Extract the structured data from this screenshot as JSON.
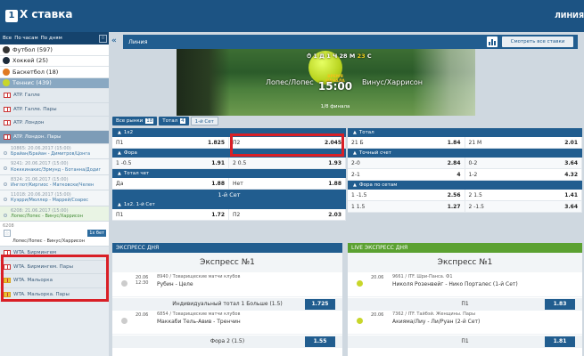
{
  "header": {
    "logo_num": "1",
    "logo_text": "X ставка",
    "nav_right": "ЛИНИЯ"
  },
  "sidebar": {
    "filters": [
      "Все",
      "По часам",
      "По дням"
    ],
    "pin": "☆",
    "collapse": "«",
    "sports": [
      {
        "label": "Футбол (597)",
        "color": "#333"
      },
      {
        "label": "Хоккей (25)",
        "color": "#1b2a3a"
      },
      {
        "label": "Баскетбол (18)",
        "color": "#e07a22"
      },
      {
        "label": "Теннис (439)",
        "color": "#c8d62a"
      }
    ],
    "leagues": [
      {
        "label": "ATP. Галле",
        "en": ""
      },
      {
        "label": "ATP. Галле. Пары",
        "en": ""
      },
      {
        "label": "ATP. Лондон",
        "en": ""
      },
      {
        "label": "ATP. Лондон. Пары",
        "en": ""
      }
    ],
    "games": [
      {
        "meta": "10865: 20.06.2017 (15:00)",
        "title": "Брайан/Брайан - Димитров/Цонга"
      },
      {
        "meta": "9241: 20.06.2017 (15:00)",
        "title": "Кокккинакис/Эрмунд - Ботанна/Додиг"
      },
      {
        "meta": "8324: 21.06.2017 (15:00)",
        "title": "Инглот/Киргиос - Матковски/Челен"
      },
      {
        "meta": "11018: 20.06.2017 (15:00)",
        "title": "Куэрри/Мюллер - Маррей/Соарес"
      },
      {
        "meta": "6208: 21.06.2017 (15:00)",
        "title": "Лопес/Лопес - Винус/Харрисон"
      }
    ],
    "slip": {
      "code": "6208",
      "label": "П2",
      "odd": "1х бет",
      "text": "Лопес/Лопес - Винус/Харрисон"
    },
    "leagues2": [
      {
        "label": "WTA. Бирмингем"
      },
      {
        "label": "WTA. Бирмингем. Пары"
      },
      {
        "label": "WTA. Мальорка"
      },
      {
        "label": "WTA. Мальорка. Пары"
      }
    ]
  },
  "main": {
    "collapse": "«",
    "line_title": "Линия",
    "all_bets": "Смотреть все ставки",
    "timer": {
      "a": "1",
      "d": "Д",
      "b": "1",
      "h": "Ч",
      "c": "28",
      "m": "М",
      "s": "23",
      "sl": "С"
    },
    "team_left": "Лопес/Лопес",
    "team_right": "Винус/Харрисон",
    "starts_label": "ВРЕМЯ НАЧАЛА",
    "start_time": "15:00",
    "round": "1/8 финала",
    "tabs": [
      {
        "label": "Все рынки",
        "n": "18"
      },
      {
        "label": "Тотал",
        "n": "4"
      },
      {
        "label": "1-й Сет",
        "n": ""
      }
    ],
    "m1x2": {
      "title": "1х2",
      "rows": [
        [
          {
            "l": "П1",
            "o": "1.825"
          },
          {
            "l": "П2",
            "o": "2.045"
          }
        ]
      ]
    },
    "fora": {
      "title": "Фора",
      "rows": [
        [
          {
            "l": "1 -0.5",
            "o": "1.91"
          },
          {
            "l": "2 0.5",
            "o": "1.93"
          }
        ]
      ]
    },
    "totalchet": {
      "title": "Тотал чет",
      "rows": [
        [
          {
            "l": "Да",
            "o": "1.88"
          },
          {
            "l": "Нет",
            "o": "1.88"
          }
        ]
      ]
    },
    "set1": "1-й Сет",
    "set1x2": {
      "title": "1х2. 1-й Сет",
      "rows": [
        [
          {
            "l": "П1",
            "o": "1.72"
          },
          {
            "l": "П2",
            "o": "2.03"
          }
        ]
      ]
    },
    "total": {
      "title": "Тотал",
      "rows": [
        [
          {
            "l": "21 Б",
            "o": "1.84"
          },
          {
            "l": "21 М",
            "o": "2.01"
          }
        ]
      ]
    },
    "exact": {
      "title": "Точный счет",
      "rows": [
        [
          {
            "l": "2-0",
            "o": "2.84"
          },
          {
            "l": "0-2",
            "o": "3.64"
          }
        ],
        [
          {
            "l": "2-1",
            "o": "4"
          },
          {
            "l": "1-2",
            "o": "4.32"
          }
        ]
      ]
    },
    "forasets": {
      "title": "Фора по сетам",
      "rows": [
        [
          {
            "l": "1 -1.5",
            "o": "2.56"
          },
          {
            "l": "2 1.5",
            "o": "1.41"
          }
        ],
        [
          {
            "l": "1 1.5",
            "o": "1.27"
          },
          {
            "l": "2 -1.5",
            "o": "3.64"
          }
        ]
      ]
    }
  },
  "express": {
    "day": {
      "header": "ЭКСПРЕСС ДНЯ",
      "title": "Экспресс №1",
      "items": [
        {
          "date": "20.06",
          "time": "12:30",
          "league": "8940 / Товарищеские матчи клубов",
          "match": "Рубин - Целе",
          "bet": "Индивидуальный тотал 1 Больше (1.5)",
          "odd": "1.725"
        },
        {
          "date": "20.06",
          "time": "",
          "league": "6854 / Товарищеские матчи клубов",
          "match": "Маккаби Тель-Авив - Тренчин",
          "bet": "Фора 2 (1.5)",
          "odd": "1.55"
        }
      ]
    },
    "live": {
      "header": "LIVE ЭКСПРЕСС ДНЯ",
      "title": "Экспресс №1",
      "items": [
        {
          "date": "20.06",
          "time": "",
          "league": "9661 / ITF. Шри-Панса. Ф1",
          "match": "Николя Розенвейг - Нико Порталес (1-й Сет)",
          "bet": "П1",
          "odd": "1.83"
        },
        {
          "date": "20.06",
          "time": "",
          "league": "7362 / ITF. Тайбэй. Женщины. Пары",
          "match": "Акияма/Лиу - Ли/Руан (2-й Сет)",
          "bet": "П1",
          "odd": "1.81"
        }
      ]
    }
  }
}
